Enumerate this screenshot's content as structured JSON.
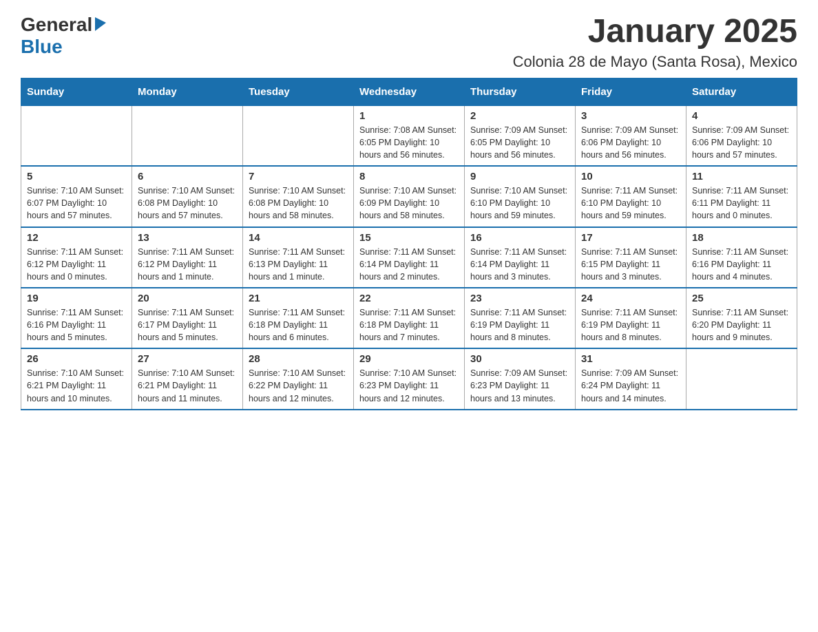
{
  "header": {
    "logo_general": "General",
    "logo_blue": "Blue",
    "month_title": "January 2025",
    "location": "Colonia 28 de Mayo (Santa Rosa), Mexico"
  },
  "days_of_week": [
    "Sunday",
    "Monday",
    "Tuesday",
    "Wednesday",
    "Thursday",
    "Friday",
    "Saturday"
  ],
  "weeks": [
    [
      {
        "day": "",
        "info": ""
      },
      {
        "day": "",
        "info": ""
      },
      {
        "day": "",
        "info": ""
      },
      {
        "day": "1",
        "info": "Sunrise: 7:08 AM\nSunset: 6:05 PM\nDaylight: 10 hours and 56 minutes."
      },
      {
        "day": "2",
        "info": "Sunrise: 7:09 AM\nSunset: 6:05 PM\nDaylight: 10 hours and 56 minutes."
      },
      {
        "day": "3",
        "info": "Sunrise: 7:09 AM\nSunset: 6:06 PM\nDaylight: 10 hours and 56 minutes."
      },
      {
        "day": "4",
        "info": "Sunrise: 7:09 AM\nSunset: 6:06 PM\nDaylight: 10 hours and 57 minutes."
      }
    ],
    [
      {
        "day": "5",
        "info": "Sunrise: 7:10 AM\nSunset: 6:07 PM\nDaylight: 10 hours and 57 minutes."
      },
      {
        "day": "6",
        "info": "Sunrise: 7:10 AM\nSunset: 6:08 PM\nDaylight: 10 hours and 57 minutes."
      },
      {
        "day": "7",
        "info": "Sunrise: 7:10 AM\nSunset: 6:08 PM\nDaylight: 10 hours and 58 minutes."
      },
      {
        "day": "8",
        "info": "Sunrise: 7:10 AM\nSunset: 6:09 PM\nDaylight: 10 hours and 58 minutes."
      },
      {
        "day": "9",
        "info": "Sunrise: 7:10 AM\nSunset: 6:10 PM\nDaylight: 10 hours and 59 minutes."
      },
      {
        "day": "10",
        "info": "Sunrise: 7:11 AM\nSunset: 6:10 PM\nDaylight: 10 hours and 59 minutes."
      },
      {
        "day": "11",
        "info": "Sunrise: 7:11 AM\nSunset: 6:11 PM\nDaylight: 11 hours and 0 minutes."
      }
    ],
    [
      {
        "day": "12",
        "info": "Sunrise: 7:11 AM\nSunset: 6:12 PM\nDaylight: 11 hours and 0 minutes."
      },
      {
        "day": "13",
        "info": "Sunrise: 7:11 AM\nSunset: 6:12 PM\nDaylight: 11 hours and 1 minute."
      },
      {
        "day": "14",
        "info": "Sunrise: 7:11 AM\nSunset: 6:13 PM\nDaylight: 11 hours and 1 minute."
      },
      {
        "day": "15",
        "info": "Sunrise: 7:11 AM\nSunset: 6:14 PM\nDaylight: 11 hours and 2 minutes."
      },
      {
        "day": "16",
        "info": "Sunrise: 7:11 AM\nSunset: 6:14 PM\nDaylight: 11 hours and 3 minutes."
      },
      {
        "day": "17",
        "info": "Sunrise: 7:11 AM\nSunset: 6:15 PM\nDaylight: 11 hours and 3 minutes."
      },
      {
        "day": "18",
        "info": "Sunrise: 7:11 AM\nSunset: 6:16 PM\nDaylight: 11 hours and 4 minutes."
      }
    ],
    [
      {
        "day": "19",
        "info": "Sunrise: 7:11 AM\nSunset: 6:16 PM\nDaylight: 11 hours and 5 minutes."
      },
      {
        "day": "20",
        "info": "Sunrise: 7:11 AM\nSunset: 6:17 PM\nDaylight: 11 hours and 5 minutes."
      },
      {
        "day": "21",
        "info": "Sunrise: 7:11 AM\nSunset: 6:18 PM\nDaylight: 11 hours and 6 minutes."
      },
      {
        "day": "22",
        "info": "Sunrise: 7:11 AM\nSunset: 6:18 PM\nDaylight: 11 hours and 7 minutes."
      },
      {
        "day": "23",
        "info": "Sunrise: 7:11 AM\nSunset: 6:19 PM\nDaylight: 11 hours and 8 minutes."
      },
      {
        "day": "24",
        "info": "Sunrise: 7:11 AM\nSunset: 6:19 PM\nDaylight: 11 hours and 8 minutes."
      },
      {
        "day": "25",
        "info": "Sunrise: 7:11 AM\nSunset: 6:20 PM\nDaylight: 11 hours and 9 minutes."
      }
    ],
    [
      {
        "day": "26",
        "info": "Sunrise: 7:10 AM\nSunset: 6:21 PM\nDaylight: 11 hours and 10 minutes."
      },
      {
        "day": "27",
        "info": "Sunrise: 7:10 AM\nSunset: 6:21 PM\nDaylight: 11 hours and 11 minutes."
      },
      {
        "day": "28",
        "info": "Sunrise: 7:10 AM\nSunset: 6:22 PM\nDaylight: 11 hours and 12 minutes."
      },
      {
        "day": "29",
        "info": "Sunrise: 7:10 AM\nSunset: 6:23 PM\nDaylight: 11 hours and 12 minutes."
      },
      {
        "day": "30",
        "info": "Sunrise: 7:09 AM\nSunset: 6:23 PM\nDaylight: 11 hours and 13 minutes."
      },
      {
        "day": "31",
        "info": "Sunrise: 7:09 AM\nSunset: 6:24 PM\nDaylight: 11 hours and 14 minutes."
      },
      {
        "day": "",
        "info": ""
      }
    ]
  ]
}
